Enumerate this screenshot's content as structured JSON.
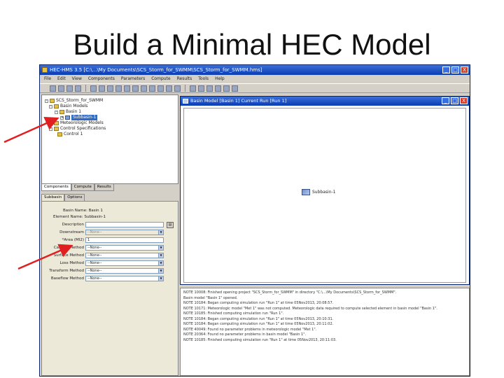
{
  "slide": {
    "title": "Build a Minimal HEC Model"
  },
  "window": {
    "title": "HEC-HMS 3.5 [C:\\...\\My Documents\\SCS_Storm_for_SWMM\\SCS_Storm_for_SWMM.hms]",
    "minimize": "_",
    "maximize": "□",
    "close": "X"
  },
  "menu": [
    "File",
    "Edit",
    "View",
    "Components",
    "Parameters",
    "Compute",
    "Results",
    "Tools",
    "Help"
  ],
  "tree": {
    "root": "SCS_Storm_for_SWMM",
    "basin_models": "Basin Models",
    "basin": "Basin 1",
    "subbasin": "Subbasin-1",
    "met_models": "Meteorologic Models",
    "control_specs": "Control Specifications",
    "control": "Control 1"
  },
  "panel_tabs": [
    "Components",
    "Compute",
    "Results"
  ],
  "prop_tabs": [
    "Subbasin",
    "Options"
  ],
  "props": {
    "basin_label": "Basin Name: Basin 1",
    "element_label": "Element Name: Subbasin-1",
    "fields": [
      {
        "label": "Description",
        "value": ""
      },
      {
        "label": "Downstream",
        "value": "--None--"
      },
      {
        "label": "*Area (MI2)",
        "value": "1"
      },
      {
        "label": "Canopy Method",
        "value": "--None--"
      },
      {
        "label": "Surface Method",
        "value": "--None--"
      },
      {
        "label": "Loss Method",
        "value": "--None--"
      },
      {
        "label": "Transform Method",
        "value": "--None--"
      },
      {
        "label": "Baseflow Method",
        "value": "--None--"
      }
    ]
  },
  "child_window": {
    "title": "Basin Model [Basin 1] Current Run [Run 1]"
  },
  "canvas": {
    "element_label": "Subbasin-1"
  },
  "log": [
    "NOTE 10008: Finished opening project \"SCS_Storm_for_SWMM\" in directory \"C:\\...\\My Documents\\SCS_Storm_for_SWMM\".",
    "Basin model \"Basin 1\" opened.",
    "NOTE 10184: Began computing simulation run \"Run 1\" at time 05Nov2013, 20:08:57.",
    "NOTE 10171: Meteorologic model \"Met 1\" was not computed. Meteorologic data required to compute selected element in basin model \"Basin 1\".",
    "NOTE 10185: Finished computing simulation run \"Run 1\".",
    "NOTE 10184: Began computing simulation run \"Run 1\" at time 05Nov2013, 20:10:31.",
    "NOTE 10184: Began computing simulation run \"Run 1\" at time 05Nov2013, 20:11:02.",
    "NOTE 40049: Found no parameter problems in meteorologic model \"Met 1\".",
    "NOTE 20364: Found no parameter problems in basin model \"Basin 1\".",
    "NOTE 10185: Finished computing simulation run \"Run 1\" at time 05Nov2013, 20:11:03."
  ]
}
